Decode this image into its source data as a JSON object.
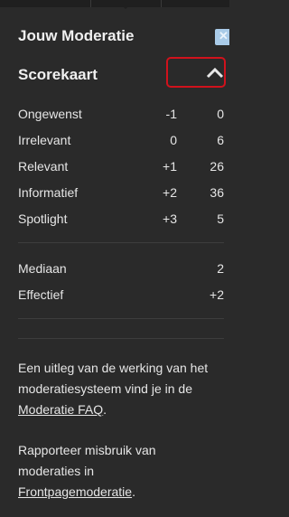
{
  "header": {
    "title": "Jouw Moderatie"
  },
  "scorecard": {
    "title": "Scorekaart",
    "rows": [
      {
        "label": "Ongewenst",
        "weight": "-1",
        "count": "0"
      },
      {
        "label": "Irrelevant",
        "weight": "0",
        "count": "6"
      },
      {
        "label": "Relevant",
        "weight": "+1",
        "count": "26"
      },
      {
        "label": "Informatief",
        "weight": "+2",
        "count": "36"
      },
      {
        "label": "Spotlight",
        "weight": "+3",
        "count": "5"
      }
    ],
    "stats": [
      {
        "label": "Mediaan",
        "value": "2"
      },
      {
        "label": "Effectief",
        "value": "+2"
      }
    ]
  },
  "info": {
    "p1_line1": "Een uitleg van de werking van het",
    "p1_line2": "moderatiesysteem vind je in de",
    "p1_link": "Moderatie FAQ",
    "p1_end": ".",
    "p2_line1": "Rapporteer misbruik van",
    "p2_line2": "moderaties in",
    "p2_link": "Frontpagemoderatie",
    "p2_end": "."
  }
}
